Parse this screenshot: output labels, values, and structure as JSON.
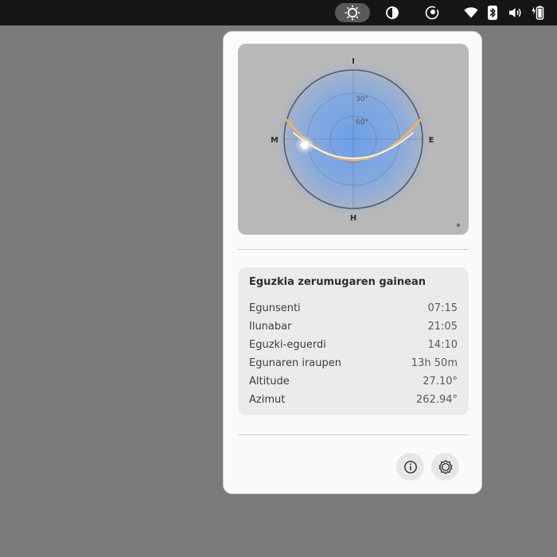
{
  "topbar": {
    "icons": [
      "sun-icon",
      "contrast-icon",
      "night-light-icon",
      "wifi-icon",
      "bluetooth-icon",
      "volume-icon",
      "battery-icon"
    ]
  },
  "diagram": {
    "compass": {
      "north": "I",
      "south": "H",
      "east": "E",
      "west": "M"
    },
    "ring_labels": {
      "inner": "60°",
      "middle": "30°"
    },
    "colors": {
      "background": "#b8b8b8",
      "glow": "#6b9fe8",
      "path": "#f5f5f5",
      "path_edge": "#e9b36a",
      "sun": "#ffffff"
    }
  },
  "sun_info": {
    "title": "Eguzkia zerumugaren gainean",
    "rows": [
      {
        "label": "Egunsenti",
        "value": "07:15"
      },
      {
        "label": "Ilunabar",
        "value": "21:05"
      },
      {
        "label": "Eguzki-eguerdi",
        "value": "14:10"
      },
      {
        "label": "Egunaren iraupen",
        "value": "13h 50m"
      },
      {
        "label": "Altitude",
        "value": "27.10°"
      },
      {
        "label": "Azimut",
        "value": "262.94°"
      }
    ]
  },
  "actions": {
    "info_icon": "info-icon",
    "settings_icon": "settings-icon"
  }
}
